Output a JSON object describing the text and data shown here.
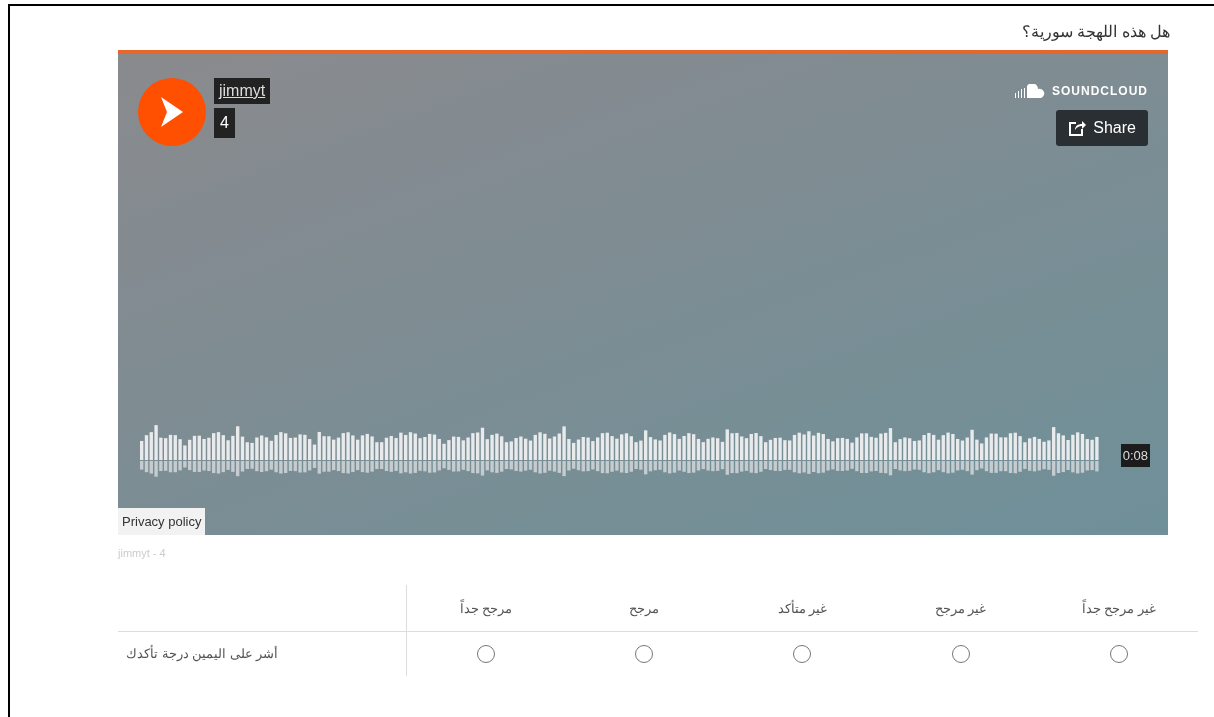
{
  "question": "هل هذه اللهجة سورية؟",
  "player": {
    "username": "jimmyt",
    "track": "4",
    "brand": "SOUNDCLOUD",
    "share": "Share",
    "duration": "0:08",
    "privacy": "Privacy policy"
  },
  "caption": "jimmyt - 4",
  "matrix": {
    "columns": [
      "غير مرجح جداً",
      "غير مرجح",
      "غير متأكد",
      "مرجح",
      "مرجح جداً"
    ],
    "rows": [
      {
        "label": "أشر على اليمين درجة تأكدك",
        "options": [
          {
            "selected": false
          },
          {
            "selected": false
          },
          {
            "selected": false
          },
          {
            "selected": false
          },
          {
            "selected": false
          }
        ]
      }
    ]
  }
}
